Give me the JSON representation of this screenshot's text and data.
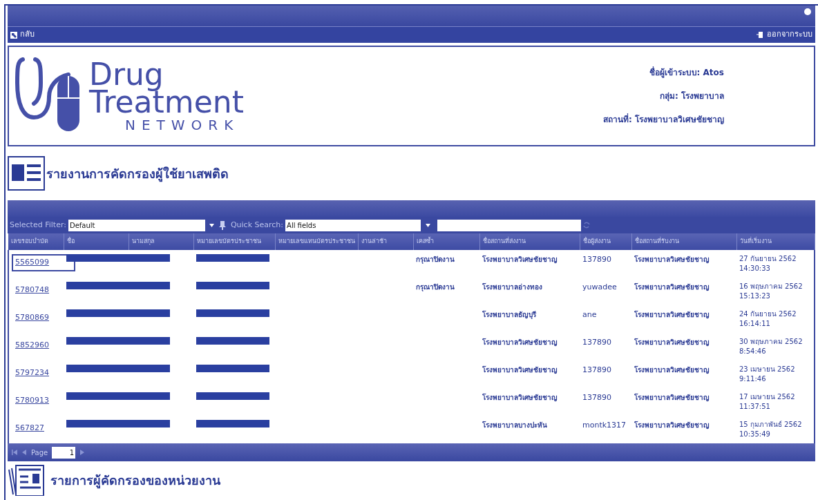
{
  "toolbar": {
    "back": "กลับ",
    "logout": "ออกจากระบบ"
  },
  "logo": {
    "line1": "Drug",
    "line2": "Treatment",
    "line3": "NETWORK"
  },
  "user_info": [
    {
      "label": "ชื่อผู้เข้าระบบ:",
      "value": "Atos"
    },
    {
      "label": "กลุ่ม:",
      "value": "โรงพยาบาล"
    },
    {
      "label": "สถานที่:",
      "value": "โรงพยาบาลวิเศษชัยชาญ"
    }
  ],
  "report_title": "รายงานการคัดกรองผู้ใช้ยาเสพติด",
  "filter": {
    "label": "Selected Filter:",
    "value": "Default",
    "search_label": "Quick Search:",
    "search_scope": "All fields"
  },
  "table": {
    "columns": [
      "เลขรอบบำบัด",
      "ชื่อ",
      "นามสกุล",
      "หมายเลขบัตรประชาชน",
      "หมายเลขแทนบัตรประชาชน",
      "งานล่าช้า",
      "เคสซ้ำ",
      "ชื่อสถานที่ส่งงาน",
      "ชื่อผู้ส่งงาน",
      "ชื่อสถานที่รับงาน",
      "วันที่เริ่มงาน"
    ],
    "rows": [
      {
        "id": "5565099",
        "selected": true,
        "name_redacted": true,
        "id_card_redacted": true,
        "duplicate": "กรุณาปิดงาน",
        "sender_place": "โรงพยาบาลวิเศษชัยชาญ",
        "sender": "137890",
        "receiver_place": "โรงพยาบาลวิเศษชัยชาญ",
        "start_date": "27 กันยายน 2562",
        "start_time": "14:30:33"
      },
      {
        "id": "5780748",
        "selected": false,
        "name_redacted": true,
        "id_card_redacted": true,
        "duplicate": "กรุณาปิดงาน",
        "sender_place": "โรงพยาบาลอ่างทอง",
        "sender": "yuwadee",
        "receiver_place": "โรงพยาบาลวิเศษชัยชาญ",
        "start_date": "16 พฤษภาคม 2562",
        "start_time": "15:13:23"
      },
      {
        "id": "5780869",
        "selected": false,
        "name_redacted": true,
        "id_card_redacted": true,
        "sender_place": "โรงพยาบาลธัญบุรี",
        "sender": "ane",
        "receiver_place": "โรงพยาบาลวิเศษชัยชาญ",
        "start_date": "24 กันยายน 2562",
        "start_time": "16:14:11"
      },
      {
        "id": "5852960",
        "selected": false,
        "name_redacted": true,
        "id_card_redacted": true,
        "sender_place": "โรงพยาบาลวิเศษชัยชาญ",
        "sender": "137890",
        "receiver_place": "โรงพยาบาลวิเศษชัยชาญ",
        "start_date": "30 พฤษภาคม 2562",
        "start_time": "8:54:46"
      },
      {
        "id": "5797234",
        "selected": false,
        "name_redacted": true,
        "id_card_redacted": true,
        "sender_place": "โรงพยาบาลวิเศษชัยชาญ",
        "sender": "137890",
        "receiver_place": "โรงพยาบาลวิเศษชัยชาญ",
        "start_date": "23 เมษายน 2562",
        "start_time": "9:11:46"
      },
      {
        "id": "5780913",
        "selected": false,
        "name_redacted": true,
        "id_card_redacted": true,
        "sender_place": "โรงพยาบาลวิเศษชัยชาญ",
        "sender": "137890",
        "receiver_place": "โรงพยาบาลวิเศษชัยชาญ",
        "start_date": "17 เมษายน 2562",
        "start_time": "11:37:51"
      },
      {
        "id": "567827",
        "selected": false,
        "name_redacted": true,
        "id_card_redacted": true,
        "sender_place": "โรงพยาบาลบางปะหัน",
        "sender": "montk1317",
        "receiver_place": "โรงพยาบาลวิเศษชัยชาญ",
        "start_date": "15 กุมภาพันธ์ 2562",
        "start_time": "10:35:49"
      }
    ]
  },
  "pager": {
    "label": "Page",
    "value": "1"
  },
  "section_title": "รายการผู้คัดกรองของหน่วยงาน"
}
